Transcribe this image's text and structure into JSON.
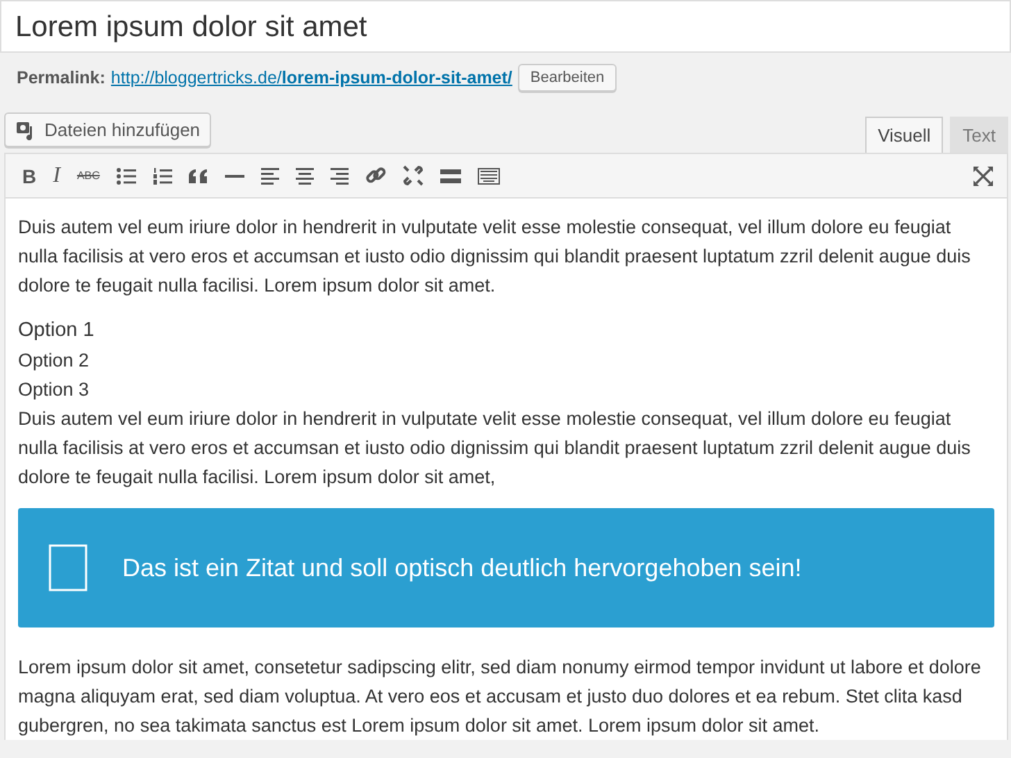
{
  "post_title": "Lorem ipsum dolor sit amet",
  "permalink": {
    "label": "Permalink:",
    "base": "http://bloggertricks.de/",
    "slug": "lorem-ipsum-dolor-sit-amet/",
    "edit_button": "Bearbeiten"
  },
  "add_media_button": "Dateien hinzufügen",
  "tabs": [
    {
      "label": "Visuell",
      "selected": true
    },
    {
      "label": "Text",
      "selected": false
    }
  ],
  "toolbar": {
    "bold": "B",
    "italic": "I",
    "strikethrough": "ABC"
  },
  "content": [
    {
      "kind": "paragraph",
      "text": "Duis autem vel eum iriure dolor in hendrerit in vulputate velit esse molestie consequat, vel illum dolore eu feugiat nulla facilisis at vero eros et accumsan et iusto odio dignissim qui blandit praesent luptatum zzril delenit augue duis dolore te feugait nulla facilisi. Lorem ipsum dolor sit amet."
    },
    {
      "kind": "lines",
      "lines": [
        "Option 1",
        "Option 2",
        "Option 3",
        "Duis autem vel eum iriure dolor in hendrerit in vulputate velit esse molestie consequat, vel illum dolore eu feugiat nulla facilisis at vero eros et accumsan et iusto odio dignissim qui blandit praesent luptatum zzril delenit augue duis dolore te feugait nulla facilisi. Lorem ipsum dolor sit amet,"
      ]
    },
    {
      "kind": "quote",
      "text": "Das ist ein Zitat und soll optisch deutlich hervorgehoben sein!"
    },
    {
      "kind": "paragraph",
      "text": "Lorem ipsum dolor sit amet, consetetur sadipscing elitr, sed diam nonumy eirmod tempor invidunt ut labore et dolore magna aliquyam erat, sed diam voluptua. At vero eos et accusam et justo duo dolores et ea rebum. Stet clita kasd gubergren, no sea takimata sanctus est Lorem ipsum dolor sit amet. Lorem ipsum dolor sit amet."
    }
  ]
}
